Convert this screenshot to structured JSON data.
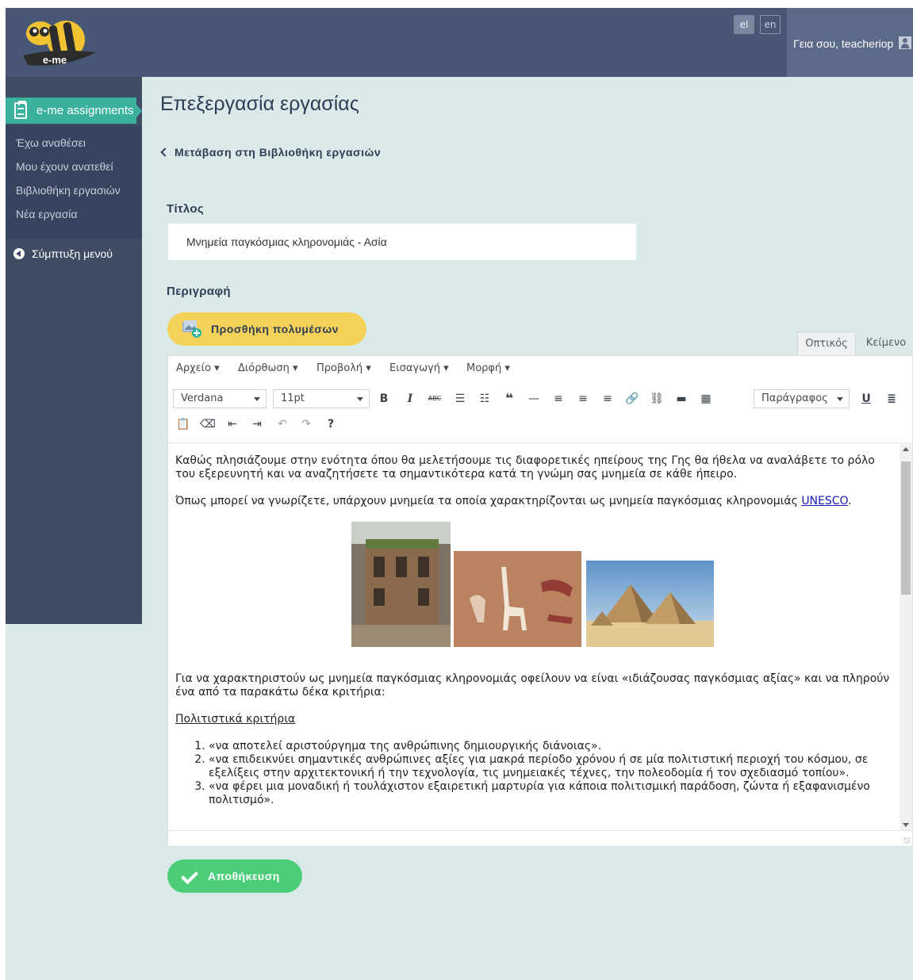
{
  "header": {
    "logo_text": "e-me",
    "languages": [
      "el",
      "en"
    ],
    "active_language": "el",
    "greeting": "Γεια σου, teacheriop",
    "icons": {
      "user": "user-icon"
    }
  },
  "sidebar": {
    "active_app": "e-me assignments",
    "links": [
      "Έχω αναθέσει",
      "Μου έχουν ανατεθεί",
      "Βιβλιοθήκη εργασιών",
      "Νέα εργασία"
    ],
    "collapse_label": "Σύμπτυξη μενού"
  },
  "main": {
    "page_title": "Επεξεργασία εργασίας",
    "back_link": "Μετάβαση στη Βιβλιοθήκη εργασιών",
    "title_label": "Τίτλος",
    "title_value": "Μνημεία παγκόσμιας κληρονομιάς - Ασία",
    "description_label": "Περιγραφή",
    "add_media_label": "Προσθήκη πολυμέσων",
    "mode_tabs": [
      "Οπτικός",
      "Κείμενο"
    ],
    "active_mode": "Οπτικός",
    "save_label": "Αποθήκευση"
  },
  "editor": {
    "menus": [
      "Αρχείο",
      "Διόρθωση",
      "Προβολή",
      "Εισαγωγή",
      "Μορφή"
    ],
    "font_family": "Verdana",
    "font_size": "11pt",
    "block_format": "Παράγραφος",
    "paragraph1": "Καθώς πλησιάζουμε στην ενότητα όπου θα μελετήσουμε τις διαφορετικές ηπείρους της Γης θα ήθελα να αναλάβετε το ρόλο του εξερευνητή και να αναζητήσετε τα σημαντικότερα κατά τη γνώμη σας μνημεία σε κάθε ήπειρο.",
    "paragraph2_prefix": "Όπως μπορεί να γνωρίζετε, υπάρχουν μνημεία τα οποία χαρακτηρίζονται ως μνημεία παγκόσμιας κληρονομιάς ",
    "paragraph2_link": "UNESCO",
    "paragraph2_suffix": ".",
    "paragraph3": "Για να χαρακτηριστούν ως μνημεία παγκόσμιας κληρονομιάς οφείλουν να είναι «ιδιάζουσας παγκόσμιας αξίας» και να πληρούν ένα από τα παρακάτω δέκα κριτήρια:",
    "criteria_heading": "Πολιτιστικά κριτήρια",
    "criteria": [
      "«να αποτελεί αριστούργημα της ανθρώπινης δημιουργικής διάνοιας».",
      "«να επιδεικνύει σημαντικές ανθρώπινες αξίες για μακρά περίοδο χρόνου ή σε μία πολιτιστική περιοχή του κόσμου, σε εξελίξεις στην αρχιτεκτονική ή την τεχνολογία, τις μνημειακές τέχνες, την πολεοδομία ή τον σχεδιασμό τοπίου».",
      "«να φέρει μια μοναδική ή τουλάχιστον εξαιρετική μαρτυρία για κάποια πολιτισμική παράδοση, ζώντα ή εξαφανισμένο πολιτισμό»."
    ],
    "images": [
      "rock-hewn-church-photo",
      "rock-art-giraffe-photo",
      "giza-pyramids-photo"
    ]
  },
  "colors": {
    "header_bg": "#475775",
    "sidebar_bg": "#3f4c66",
    "accent_teal": "#3ab29e",
    "main_bg": "#d9eae8",
    "media_button": "#f4d25a",
    "save_button": "#4cce78"
  }
}
